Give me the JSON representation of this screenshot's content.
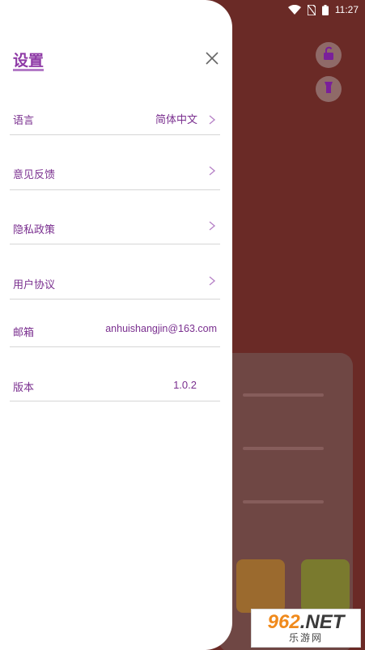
{
  "status_bar": {
    "time": "11:27",
    "icons": [
      "wifi-icon",
      "no-sim-icon",
      "battery-icon"
    ]
  },
  "background_app": {
    "buttons": [
      "lock-open-icon",
      "flashlight-icon"
    ],
    "tile_colors": [
      "#9b6a2e",
      "#7a7a2e"
    ],
    "bg_color": "#6a2a26"
  },
  "settings": {
    "title": "设置",
    "close_icon": "close-icon",
    "items": [
      {
        "label": "语言",
        "value": "简体中文",
        "has_chevron": true
      },
      {
        "label": "意见反馈",
        "value": "",
        "has_chevron": true
      },
      {
        "label": "隐私政策",
        "value": "",
        "has_chevron": true
      },
      {
        "label": "用户协议",
        "value": "",
        "has_chevron": true
      },
      {
        "label": "邮箱",
        "value": "anhuishangjin@163.com",
        "has_chevron": false
      },
      {
        "label": "版本",
        "value": "1.0.2",
        "has_chevron": false
      }
    ],
    "accent_color": "#7a2f8f"
  },
  "watermark": {
    "numbers": "962",
    "suffix": ".NET",
    "subtitle": "乐游网"
  }
}
